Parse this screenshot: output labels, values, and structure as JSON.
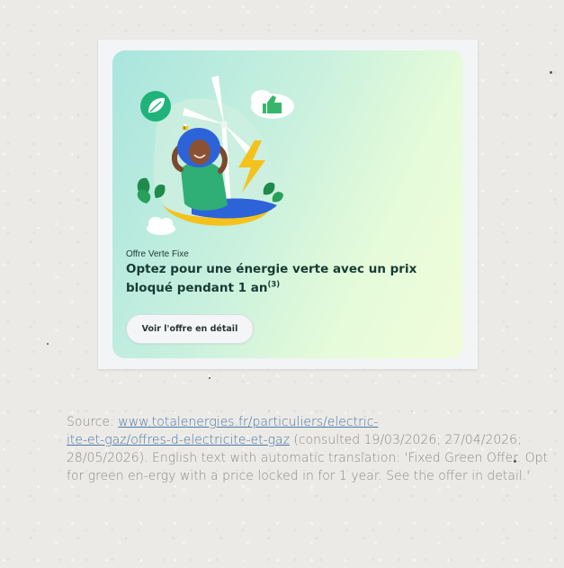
{
  "offer": {
    "label": "Offre Verte Fixe",
    "title": "Optez pour une énergie verte avec un prix bloqué pendant 1 an",
    "title_footnote": "(3)",
    "button_label": "Voir l'offre en détail"
  },
  "caption": {
    "prefix": "Source: ",
    "link_line1": "www.totalenergies.fr/particuliers/electric-",
    "link_line2": "ite-et-gaz/offres-d-electricite-et-gaz",
    "consulted": " (consulted 19/03/2026; 27/04/2026; 28/05/2026). English text with automatic translation: 'Fixed Green Offer. Opt for green en-ergy with a price locked in for 1 year. See the offer in detail.'"
  },
  "colors": {
    "card_gradient_start": "#a9e5de",
    "card_gradient_end": "#f0fcdc",
    "title_text": "#173b33",
    "leaf_badge": "#1fb37b",
    "bolt": "#f4c21b",
    "person_hair": "#2d63d8",
    "person_shirt": "#2fae75",
    "caption_text": "#8b8b8b",
    "caption_link": "#4a78a8"
  },
  "icons": [
    "leaf-badge-icon",
    "wind-turbine-icon",
    "thumbs-up-cloud-icon",
    "lightning-bolt-icon",
    "bee-icon",
    "cloud-icon",
    "plant-leaves-icon"
  ]
}
